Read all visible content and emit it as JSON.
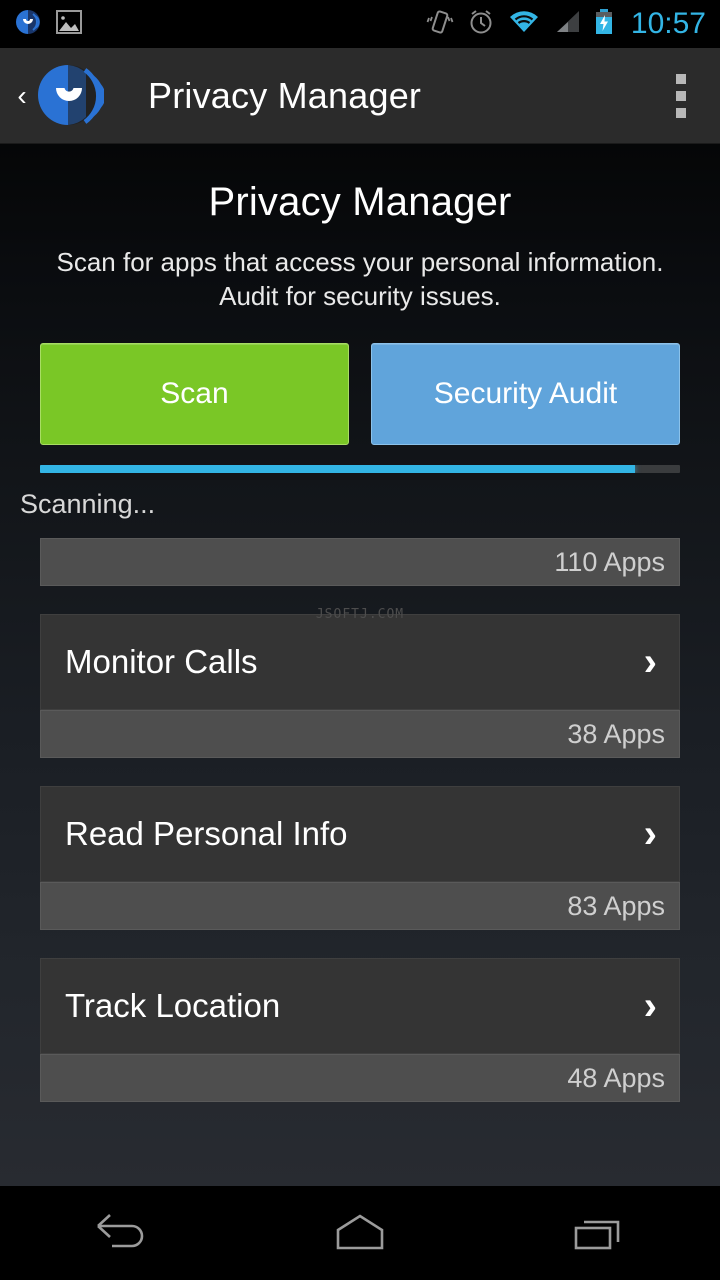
{
  "statusbar": {
    "time": "10:57",
    "left_icons": [
      "app-notification-icon",
      "gallery-image-icon"
    ],
    "right_icons": [
      "vibrate-icon",
      "alarm-clock-icon",
      "wifi-icon",
      "cellular-signal-icon",
      "battery-charging-icon"
    ],
    "accent_color": "#33b5e5"
  },
  "actionbar": {
    "back_glyph": "‹",
    "title": "Privacy Manager",
    "logo_name": "malwarebytes-logo",
    "logo_color": "#2a72d4",
    "overflow_name": "overflow-menu"
  },
  "header": {
    "title": "Privacy Manager",
    "subtitle": "Scan for apps that access your personal information. Audit for security issues."
  },
  "actions": {
    "scan_label": "Scan",
    "scan_color": "#7ac726",
    "audit_label": "Security Audit",
    "audit_color": "#60a4db"
  },
  "progress": {
    "percent": 93,
    "status_text": "Scanning...",
    "bar_color": "#33b5e5",
    "track_color": "#3a3c3e"
  },
  "watermark": "JSOFTJ.COM",
  "list": {
    "top_badge": "110 Apps",
    "items": [
      {
        "label": "Monitor Calls",
        "badge": "38 Apps",
        "chevron": "›"
      },
      {
        "label": "Read Personal Info",
        "badge": "83 Apps",
        "chevron": "›"
      },
      {
        "label": "Track Location",
        "badge": "48 Apps",
        "chevron": "›"
      }
    ]
  },
  "navbar": {
    "back_name": "nav-back-icon",
    "home_name": "nav-home-icon",
    "recents_name": "nav-recents-icon"
  }
}
